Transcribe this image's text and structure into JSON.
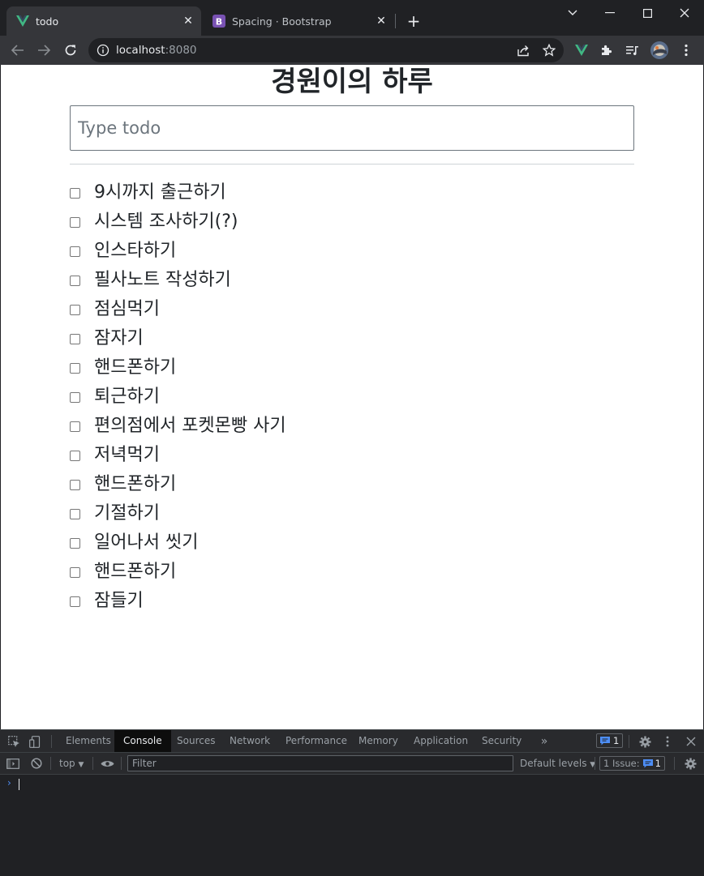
{
  "browser": {
    "tabs": [
      {
        "title": "todo",
        "icon": "vue-logo-icon",
        "active": true
      },
      {
        "title": "Spacing · Bootstrap",
        "icon": "bootstrap-logo-icon",
        "active": false
      }
    ],
    "url_host": "localhost",
    "url_port": ":8080",
    "colors": {
      "vue_green": "#41b883",
      "bootstrap_purple": "#7952b3"
    }
  },
  "page": {
    "title": "경원이의 하루",
    "input_placeholder": "Type todo",
    "todos": [
      "9시까지 출근하기",
      "시스템 조사하기(?)",
      "인스타하기",
      "필사노트 작성하기",
      "점심먹기",
      "잠자기",
      "핸드폰하기",
      "퇴근하기",
      "편의점에서 포켓몬빵 사기",
      "저녁먹기",
      "핸드폰하기",
      "기절하기",
      "일어나서 씻기",
      "핸드폰하기",
      "잠들기"
    ]
  },
  "devtools": {
    "tabs": [
      "Elements",
      "Console",
      "Sources",
      "Network",
      "Performance",
      "Memory",
      "Application",
      "Security"
    ],
    "active_tab": "Console",
    "messages_badge": "1",
    "context": "top",
    "filter_placeholder": "Filter",
    "levels": "Default levels",
    "issues_label": "1 Issue:",
    "issues_count": "1"
  }
}
